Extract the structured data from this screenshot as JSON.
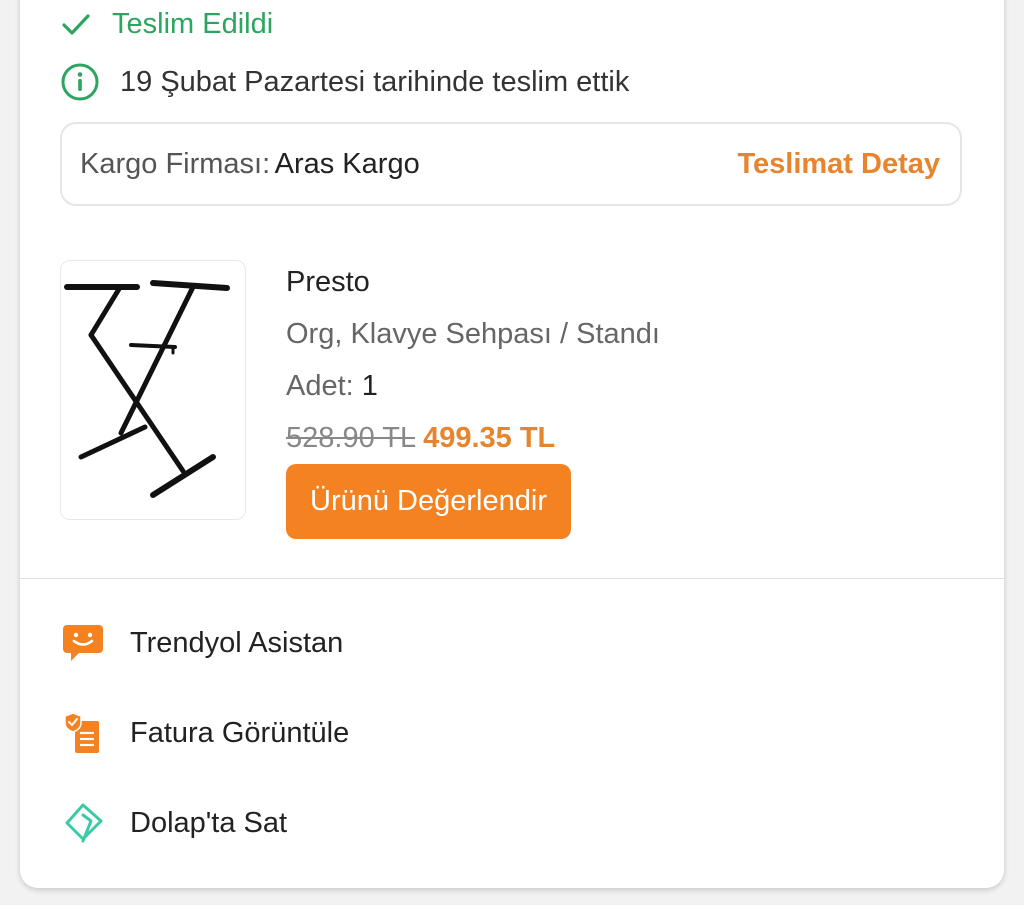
{
  "delivery": {
    "status": "Teslim Edildi",
    "info": "19 Şubat Pazartesi tarihinde teslim ettik"
  },
  "cargo": {
    "label": "Kargo Firması:",
    "company": "Aras Kargo",
    "detail_link": "Teslimat Detay"
  },
  "product": {
    "brand": "Presto",
    "name": "Org, Klavye Sehpası / Standı",
    "quantity_label": "Adet:",
    "quantity_value": "1",
    "old_price": "528.90 TL",
    "new_price": "499.35 TL",
    "rate_button": "Ürünü Değerlendir"
  },
  "menu": {
    "items": [
      {
        "label": "Trendyol Asistan",
        "icon": "assistant-chat-icon"
      },
      {
        "label": "Fatura Görüntüle",
        "icon": "invoice-icon"
      },
      {
        "label": "Dolap'ta Sat",
        "icon": "dolap-tag-icon"
      }
    ]
  },
  "colors": {
    "success": "#2ba55f",
    "accent": "#f58220",
    "accent_text": "#e8842c",
    "dolap": "#3cc9a6"
  }
}
